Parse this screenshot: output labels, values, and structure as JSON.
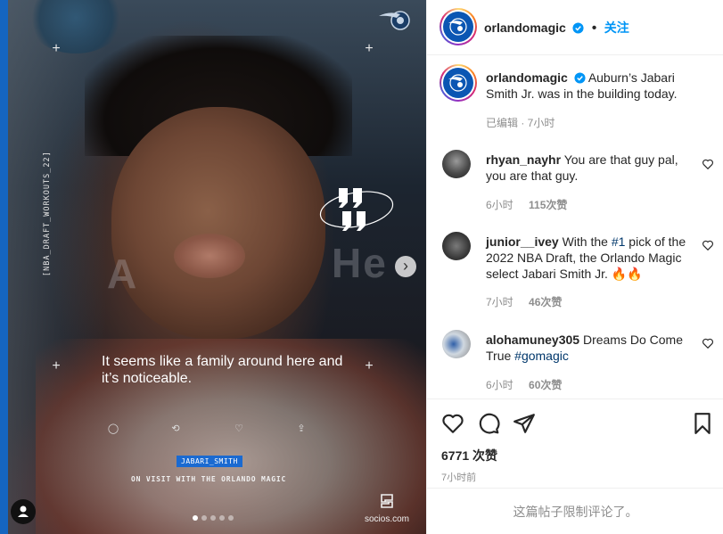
{
  "post": {
    "author": "orlandomagic",
    "follow_label": "关注",
    "separator": "•",
    "caption": "Auburn’s Jabari Smith Jr. was in the building today.",
    "caption_meta": "已编辑 · 7小时",
    "likes": "6771 次赞",
    "time_ago": "7小时前",
    "comments_limited": "这篇帖子限制评论了。"
  },
  "media": {
    "vertical_tag": "[NBA_DRAFT_WORKOUTS_22]",
    "quote": "It seems like a family around here and it’s noticeable.",
    "name_tag": "JABARI_SMITH",
    "subtitle": "ON VISIT WITH THE ORLANDO MAGIC",
    "sponsor": "socios.com",
    "bg_letters_left": "A",
    "bg_letters_right": "He",
    "slide_count": 5,
    "active_slide": 1
  },
  "comments": [
    {
      "user": "rhyan_nayhr",
      "text": "You are that guy pal, you are that guy.",
      "time": "6小时",
      "likes": "115次赞"
    },
    {
      "user": "junior__ivey",
      "text_before": "With the ",
      "link": "#1",
      "text_after": " pick of the 2022 NBA Draft, the Orlando Magic select Jabari Smith Jr. 🔥🔥",
      "time": "7小时",
      "likes": "46次赞"
    },
    {
      "user": "alohamuney305",
      "text_before": "Dreams Do Come True ",
      "link": "#gomagic",
      "time": "6小时",
      "likes": "60次赞"
    }
  ],
  "icons": {
    "like": "heart-icon",
    "comment": "comment-icon",
    "share": "paper-plane-icon",
    "save": "bookmark-icon",
    "next": "chevron-right-icon",
    "verified": "verified-badge-icon"
  },
  "colors": {
    "accent": "#0095f6",
    "brand_blue": "#0b56b3",
    "muted": "#8e8e8e",
    "link": "#00376b"
  }
}
